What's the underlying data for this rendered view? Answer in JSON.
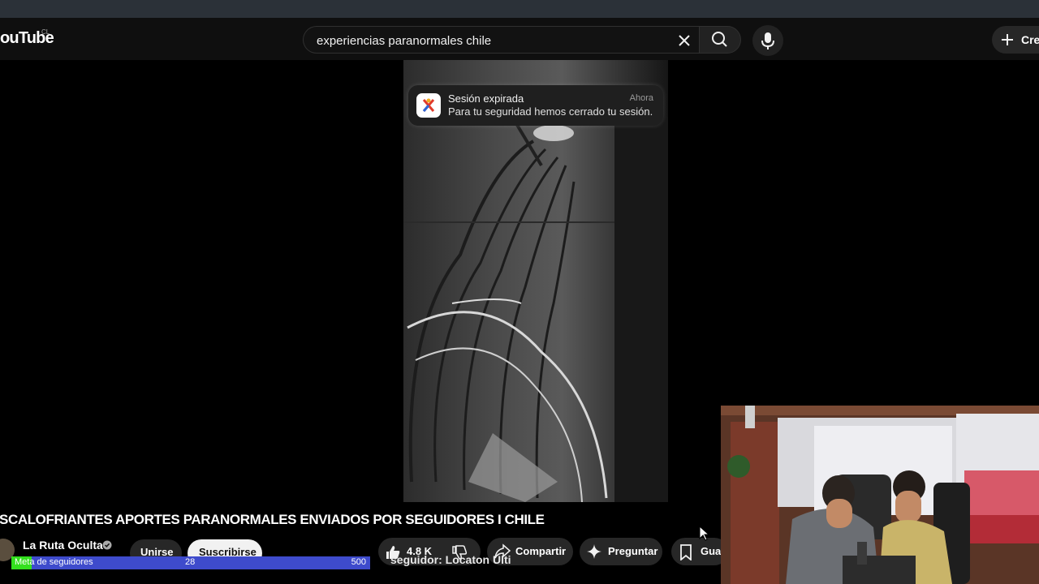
{
  "header": {
    "logo_text": "ouTube",
    "country_code": "CL",
    "search_value": "experiencias paranormales chile",
    "create_label": "Crea"
  },
  "notification": {
    "title": "Sesión expirada",
    "time": "Ahora",
    "body": "Para tu seguridad hemos cerrado tu sesión."
  },
  "video": {
    "title": "SCALOFRIANTES APORTES PARANORMALES ENVIADOS POR SEGUIDORES I CHILE",
    "channel_name": "La Ruta Oculta",
    "join_label": "Unirse",
    "subscribe_label": "Suscribirse",
    "likes": "4.8 K",
    "share_label": "Compartir",
    "ask_label": "Preguntar",
    "save_label": "Guar"
  },
  "goal": {
    "label": "Meta de seguidores",
    "current": "28",
    "target": "500",
    "progress_fraction": 0.056
  },
  "overlay": {
    "text": "seguidor: Locaton  Ulti"
  },
  "colors": {
    "goal_bar": "#3e4bcc",
    "goal_fill": "#33e01e",
    "topbar": "#0f0f0f"
  },
  "icons": [
    "clear-icon",
    "search-icon",
    "mic-icon",
    "plus-icon",
    "verified-icon",
    "like-icon",
    "dislike-icon",
    "share-icon",
    "sparkle-icon",
    "bookmark-icon",
    "cursor-icon"
  ]
}
